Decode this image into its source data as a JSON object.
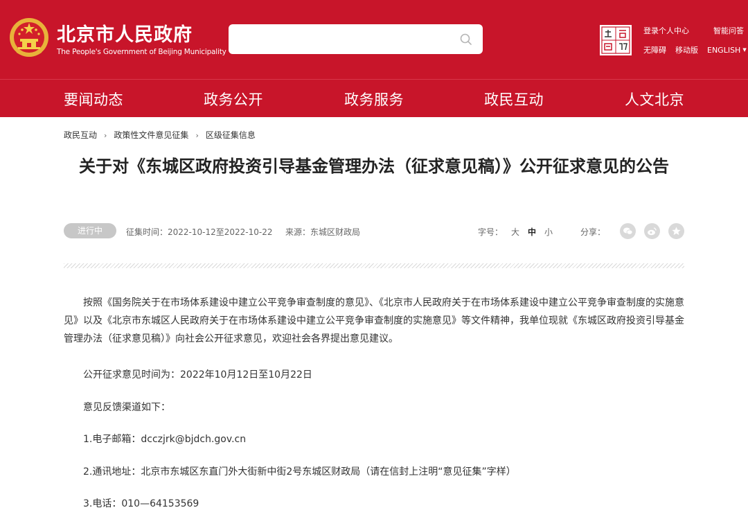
{
  "header": {
    "title": "北京市人民政府",
    "subtitle": "The People's Government of Beijing Municipality",
    "search": {
      "placeholder": "",
      "value": ""
    },
    "links": {
      "personal_center": "登录个人中心",
      "smart_qa": "智能问答",
      "accessibility": "无障碍",
      "mobile": "移动版",
      "language": "ENGLISH"
    }
  },
  "nav": {
    "items": [
      {
        "label": "要闻动态"
      },
      {
        "label": "政务公开"
      },
      {
        "label": "政务服务"
      },
      {
        "label": "政民互动"
      },
      {
        "label": "人文北京"
      }
    ]
  },
  "breadcrumb": [
    "政民互动",
    "政策性文件意见征集",
    "区级征集信息"
  ],
  "article": {
    "title": "关于对《东城区政府投资引导基金管理办法（征求意见稿）》公开征求意见的公告",
    "status": "进行中",
    "period": "征集时间：2022-10-12至2022-10-22",
    "source": "来源：东城区财政局",
    "font_size_label": "字号：",
    "font_sizes": [
      "大",
      "中",
      "小"
    ],
    "share_label": "分享：",
    "share_icons": [
      "wechat-icon",
      "weibo-icon",
      "favorite-icon"
    ],
    "paragraph": "按照《国务院关于在市场体系建设中建立公平竞争审查制度的意见》、《北京市人民政府关于在市场体系建设中建立公平竞争审查制度的实施意见》以及《北京市东城区人民政府关于在市场体系建设中建立公平竞争审查制度的实施意见》等文件精神，我单位现就《东城区政府投资引导基金管理办法（征求意见稿）》向社会公开征求意见，欢迎社会各界提出意见建议。",
    "lines": [
      "公开征求意见时间为：2022年10月12日至10月22日",
      "意见反馈渠道如下：",
      "1.电子邮箱：dcczjrk@bjdch.gov.cn",
      "2.通讯地址：北京市东城区东直门外大街新中街2号东城区财政局（请在信封上注明“意见征集”字样）",
      "3.电话：010—64153569"
    ]
  },
  "colors": {
    "brand_red": "#c8152a",
    "badge_gray": "#c7c7c7",
    "share_gray": "#d9d9d9"
  }
}
